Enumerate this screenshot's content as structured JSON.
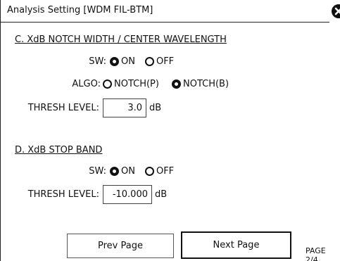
{
  "window": {
    "title": "Analysis Setting [WDM FIL-BTM]"
  },
  "section_c": {
    "heading": "C. XdB NOTCH WIDTH / CENTER WAVELENGTH",
    "sw_label": "SW:",
    "sw_options": [
      "ON",
      "OFF"
    ],
    "sw_selected": "ON",
    "algo_label": "ALGO:",
    "algo_options": [
      "NOTCH(P)",
      "NOTCH(B)"
    ],
    "algo_selected": "NOTCH(B)",
    "thresh_label": "THRESH LEVEL:",
    "thresh_value": "3.0",
    "thresh_unit": "dB"
  },
  "section_d": {
    "heading": "D. XdB STOP BAND",
    "sw_label": "SW:",
    "sw_options": [
      "ON",
      "OFF"
    ],
    "sw_selected": "ON",
    "thresh_label": "THRESH LEVEL:",
    "thresh_value": "-10.000",
    "thresh_unit": "dB"
  },
  "footer": {
    "prev_label": "Prev Page",
    "next_label": "Next Page",
    "page_indicator": "PAGE 2/4"
  },
  "icons": {
    "close": "close-icon"
  }
}
